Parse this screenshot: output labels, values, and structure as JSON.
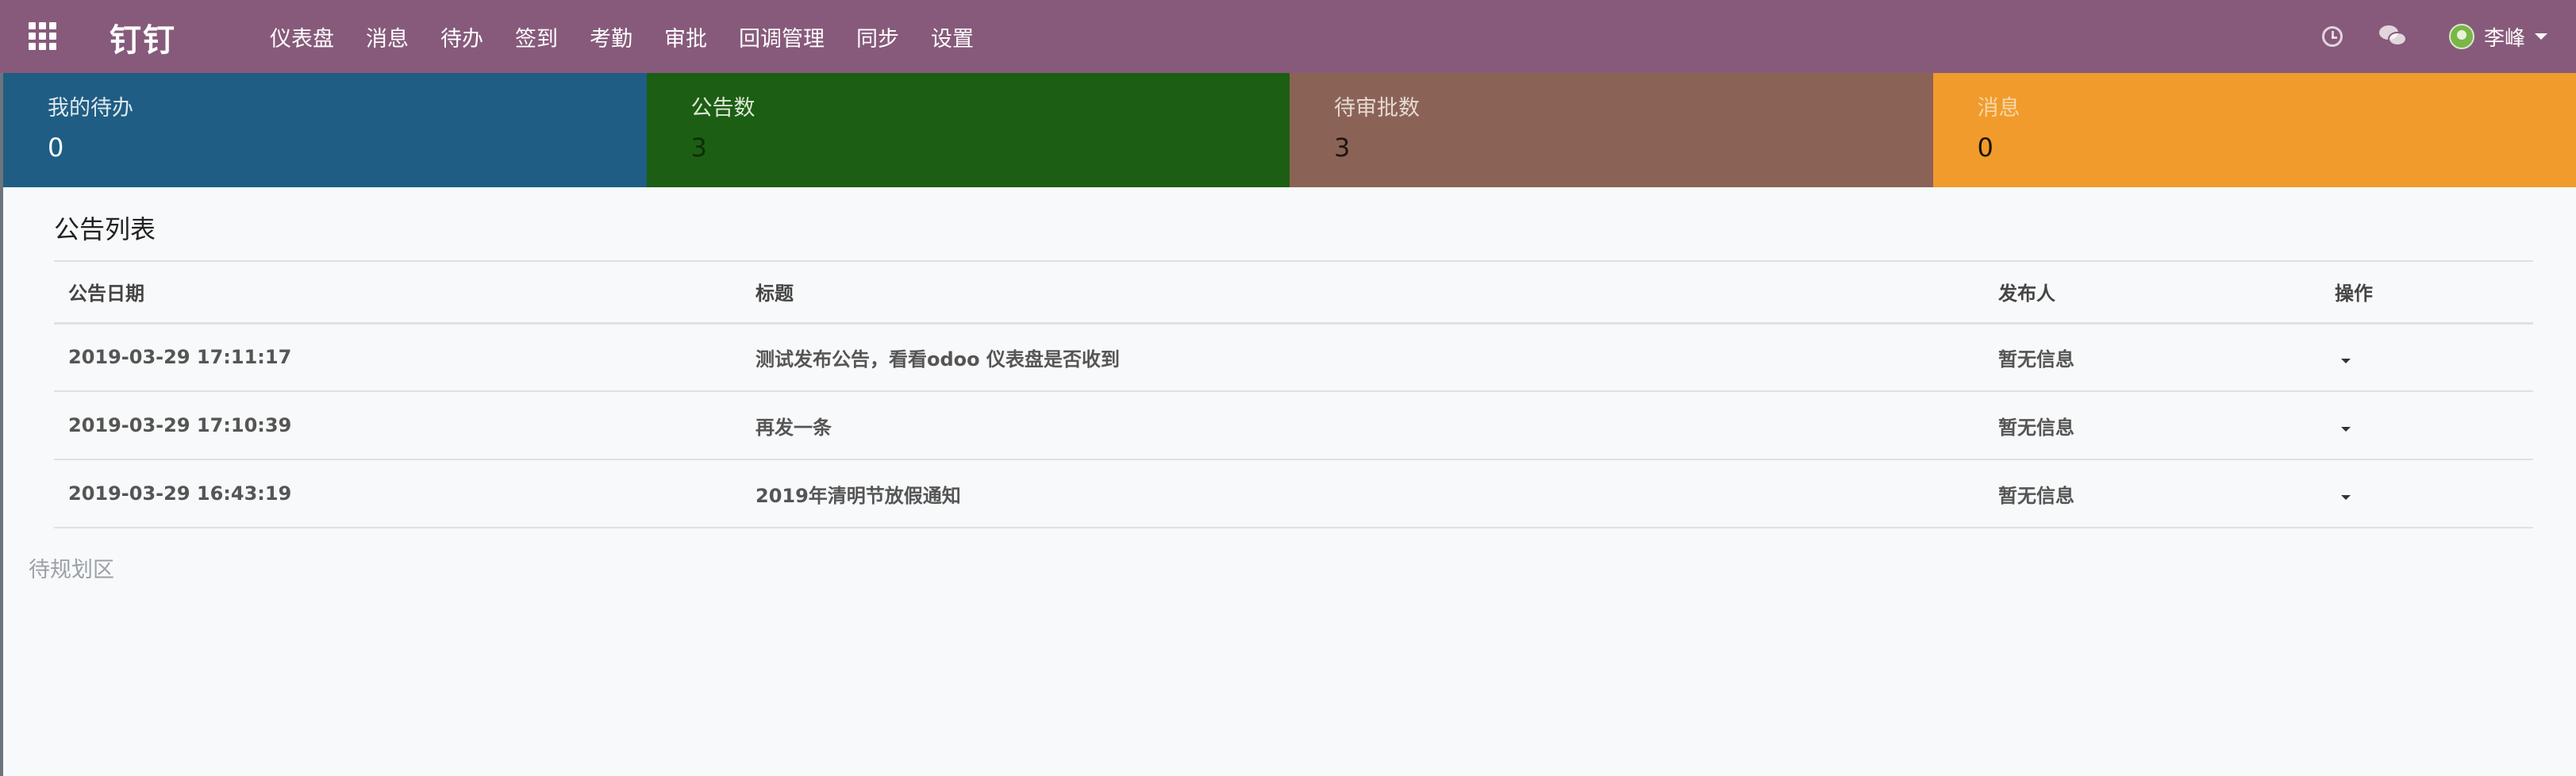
{
  "app": {
    "brand": "钉钉"
  },
  "nav": {
    "items": [
      "仪表盘",
      "消息",
      "待办",
      "签到",
      "考勤",
      "审批",
      "回调管理",
      "同步",
      "设置"
    ],
    "user": "李峰"
  },
  "tiles": [
    {
      "label": "我的待办",
      "value": "0",
      "bg": "#1f5d84",
      "label_color": "#dfe8ee",
      "value_color": "#ffffff"
    },
    {
      "label": "公告数",
      "value": "3",
      "bg": "#1b5e14",
      "label_color": "#dfe8d6",
      "value_color": "#0f2e0a"
    },
    {
      "label": "待审批数",
      "value": "3",
      "bg": "#8b6356",
      "label_color": "#e6d9d3",
      "value_color": "#1f1410"
    },
    {
      "label": "消息",
      "value": "0",
      "bg": "#f19b2c",
      "label_color": "#f8d7a8",
      "value_color": "#1c1206"
    }
  ],
  "announcements": {
    "title": "公告列表",
    "columns": [
      "公告日期",
      "标题",
      "发布人",
      "操作"
    ],
    "rows": [
      {
        "date": "2019-03-29 17:11:17",
        "title": "测试发布公告，看看odoo 仪表盘是否收到",
        "publisher": "暂无信息"
      },
      {
        "date": "2019-03-29 17:10:39",
        "title": "再发一条",
        "publisher": "暂无信息"
      },
      {
        "date": "2019-03-29 16:43:19",
        "title": "2019年清明节放假通知",
        "publisher": "暂无信息"
      }
    ]
  },
  "planned_area": "待规划区"
}
